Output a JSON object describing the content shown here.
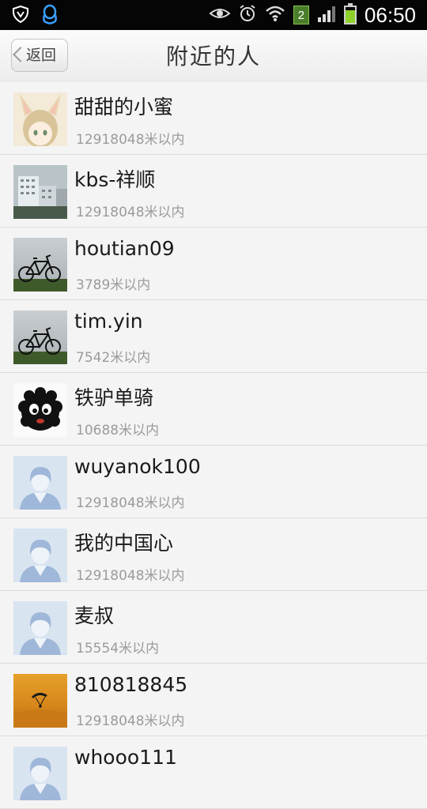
{
  "status_bar": {
    "time": "06:50",
    "notification_count": "2",
    "battery_level": 0.8,
    "icons": [
      "shield-icon",
      "qq-penguin-icon",
      "eye-icon",
      "alarm-icon",
      "wifi-icon",
      "sim-badge",
      "signal-icon",
      "battery-icon"
    ]
  },
  "header": {
    "back_label": "返回",
    "title": "附近的人"
  },
  "people": [
    {
      "name": "甜甜的小蜜",
      "distance": "12918048米以内",
      "avatar": "bunny-girl"
    },
    {
      "name": "kbs-祥顺",
      "distance": "12918048米以内",
      "avatar": "buildings"
    },
    {
      "name": "houtian09",
      "distance": "3789米以内",
      "avatar": "bicycle"
    },
    {
      "name": "tim.yin",
      "distance": "7542米以内",
      "avatar": "bicycle"
    },
    {
      "name": "铁驴单骑",
      "distance": "10688米以内",
      "avatar": "fuzzy-creature"
    },
    {
      "name": "wuyanok100",
      "distance": "12918048米以内",
      "avatar": "default"
    },
    {
      "name": "我的中国心",
      "distance": "12918048米以内",
      "avatar": "default"
    },
    {
      "name": "麦叔",
      "distance": "15554米以内",
      "avatar": "default"
    },
    {
      "name": "810818845",
      "distance": "12918048米以内",
      "avatar": "paraglider"
    },
    {
      "name": "whooo111",
      "distance": "",
      "avatar": "default"
    }
  ]
}
